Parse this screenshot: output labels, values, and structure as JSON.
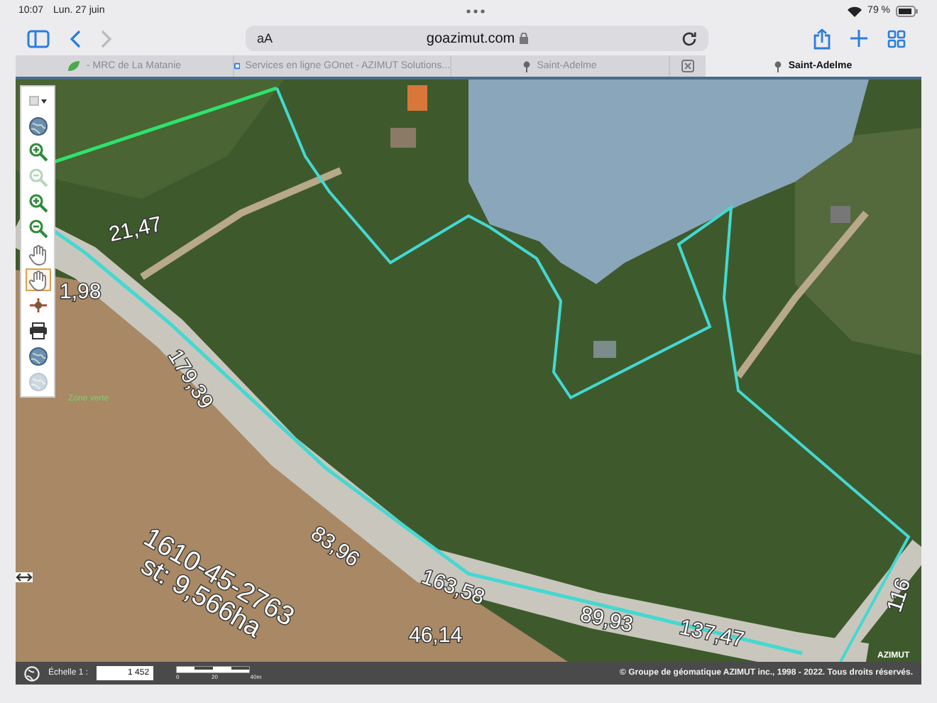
{
  "status_bar": {
    "time": "10:07",
    "date": "Lun. 27 juin",
    "battery": "79 %"
  },
  "toolbar": {
    "text_size": "aA",
    "address": "goazimut.com",
    "back_disabled": false,
    "forward_disabled": true
  },
  "tabs": [
    {
      "label": "- MRC de La Matanie",
      "kind": "leaf",
      "selected": false
    },
    {
      "label": "Services en ligne GOnet - AZIMUT Solutions...",
      "kind": "app",
      "selected": false
    },
    {
      "label": "Saint-Adelme",
      "kind": "pin",
      "selected": false
    },
    {
      "label": "Saint-Adelme",
      "kind": "pin",
      "selected": true
    }
  ],
  "map_tools": [
    {
      "kind": "layers",
      "selected": false,
      "disabled": false
    },
    {
      "kind": "globe",
      "selected": false,
      "disabled": false
    },
    {
      "kind": "zoom-in",
      "selected": false,
      "disabled": false
    },
    {
      "kind": "zoom-out",
      "selected": false,
      "disabled": true
    },
    {
      "kind": "zoom-in",
      "selected": false,
      "disabled": false
    },
    {
      "kind": "zoom-out",
      "selected": false,
      "disabled": false
    },
    {
      "kind": "pan",
      "selected": false,
      "disabled": false
    },
    {
      "kind": "pan",
      "selected": true,
      "disabled": false
    },
    {
      "kind": "measure",
      "selected": false,
      "disabled": false
    },
    {
      "kind": "print",
      "selected": false,
      "disabled": false
    },
    {
      "kind": "globe",
      "selected": false,
      "disabled": false
    },
    {
      "kind": "globe",
      "selected": false,
      "disabled": true
    }
  ],
  "map": {
    "zone_label": "Zone verte",
    "dimension_labels": [
      {
        "text": "21,47"
      },
      {
        "text": "1,98"
      },
      {
        "text": "179,39"
      },
      {
        "text": "83,96"
      },
      {
        "text": "163,58"
      },
      {
        "text": "89,93"
      },
      {
        "text": "137,47"
      },
      {
        "text": "46,14"
      },
      {
        "text": "116"
      }
    ],
    "lot_number": "1610-45-2763",
    "lot_area": "st: 9,566ha",
    "logo": "AZIMUT"
  },
  "footer": {
    "scale_label": "Échelle 1 :",
    "scale_value": "1 452",
    "scale_ticks": [
      "0",
      "20",
      "40m"
    ],
    "copyright": "© Groupe de géomatique AZIMUT inc., 1998 - 2022. Tous droits réservés."
  }
}
